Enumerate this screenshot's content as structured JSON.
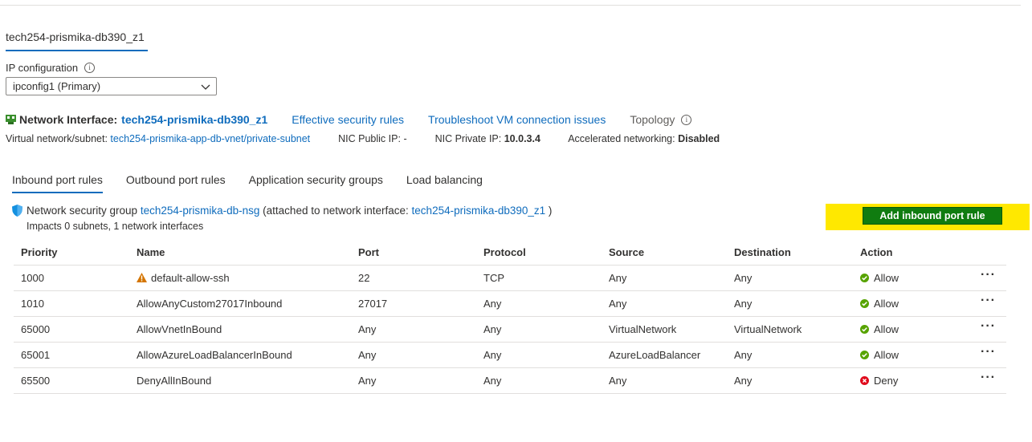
{
  "nic_tab": "tech254-prismika-db390_z1",
  "ip_config": {
    "label": "IP configuration",
    "selected": "ipconfig1 (Primary)"
  },
  "nic": {
    "label": "Network Interface:",
    "name": "tech254-prismika-db390_z1",
    "effective_rules": "Effective security rules",
    "troubleshoot": "Troubleshoot VM connection issues",
    "topology": "Topology"
  },
  "vnet": {
    "label": "Virtual network/subnet:",
    "value": "tech254-prismika-app-db-vnet/private-subnet",
    "public_ip_label": "NIC Public IP:",
    "public_ip": "-",
    "private_ip_label": "NIC Private IP:",
    "private_ip": "10.0.3.4",
    "accel_label": "Accelerated networking:",
    "accel_value": "Disabled"
  },
  "tabs": [
    {
      "label": "Inbound port rules",
      "active": true
    },
    {
      "label": "Outbound port rules",
      "active": false
    },
    {
      "label": "Application security groups",
      "active": false
    },
    {
      "label": "Load balancing",
      "active": false
    }
  ],
  "nsg": {
    "prefix": "Network security group",
    "name": "tech254-prismika-db-nsg",
    "attached_prefix": "(attached to network interface:",
    "attached_nic": "tech254-prismika-db390_z1",
    "attached_suffix": ")",
    "impacts": "Impacts 0 subnets, 1 network interfaces"
  },
  "add_button": "Add inbound port rule",
  "colors": {
    "link": "#0f6cbd",
    "highlight": "#ffe800",
    "button": "#107c10",
    "allow": "#57a300",
    "deny": "#e00b1c",
    "warning": "#d47500"
  },
  "table": {
    "headers": [
      "Priority",
      "Name",
      "Port",
      "Protocol",
      "Source",
      "Destination",
      "Action"
    ],
    "rows": [
      {
        "priority": "1000",
        "name": "default-allow-ssh",
        "warning": true,
        "port": "22",
        "protocol": "TCP",
        "source": "Any",
        "destination": "Any",
        "action": "Allow"
      },
      {
        "priority": "1010",
        "name": "AllowAnyCustom27017Inbound",
        "warning": false,
        "port": "27017",
        "protocol": "Any",
        "source": "Any",
        "destination": "Any",
        "action": "Allow"
      },
      {
        "priority": "65000",
        "name": "AllowVnetInBound",
        "warning": false,
        "port": "Any",
        "protocol": "Any",
        "source": "VirtualNetwork",
        "destination": "VirtualNetwork",
        "action": "Allow"
      },
      {
        "priority": "65001",
        "name": "AllowAzureLoadBalancerInBound",
        "warning": false,
        "port": "Any",
        "protocol": "Any",
        "source": "AzureLoadBalancer",
        "destination": "Any",
        "action": "Allow"
      },
      {
        "priority": "65500",
        "name": "DenyAllInBound",
        "warning": false,
        "port": "Any",
        "protocol": "Any",
        "source": "Any",
        "destination": "Any",
        "action": "Deny"
      }
    ]
  }
}
